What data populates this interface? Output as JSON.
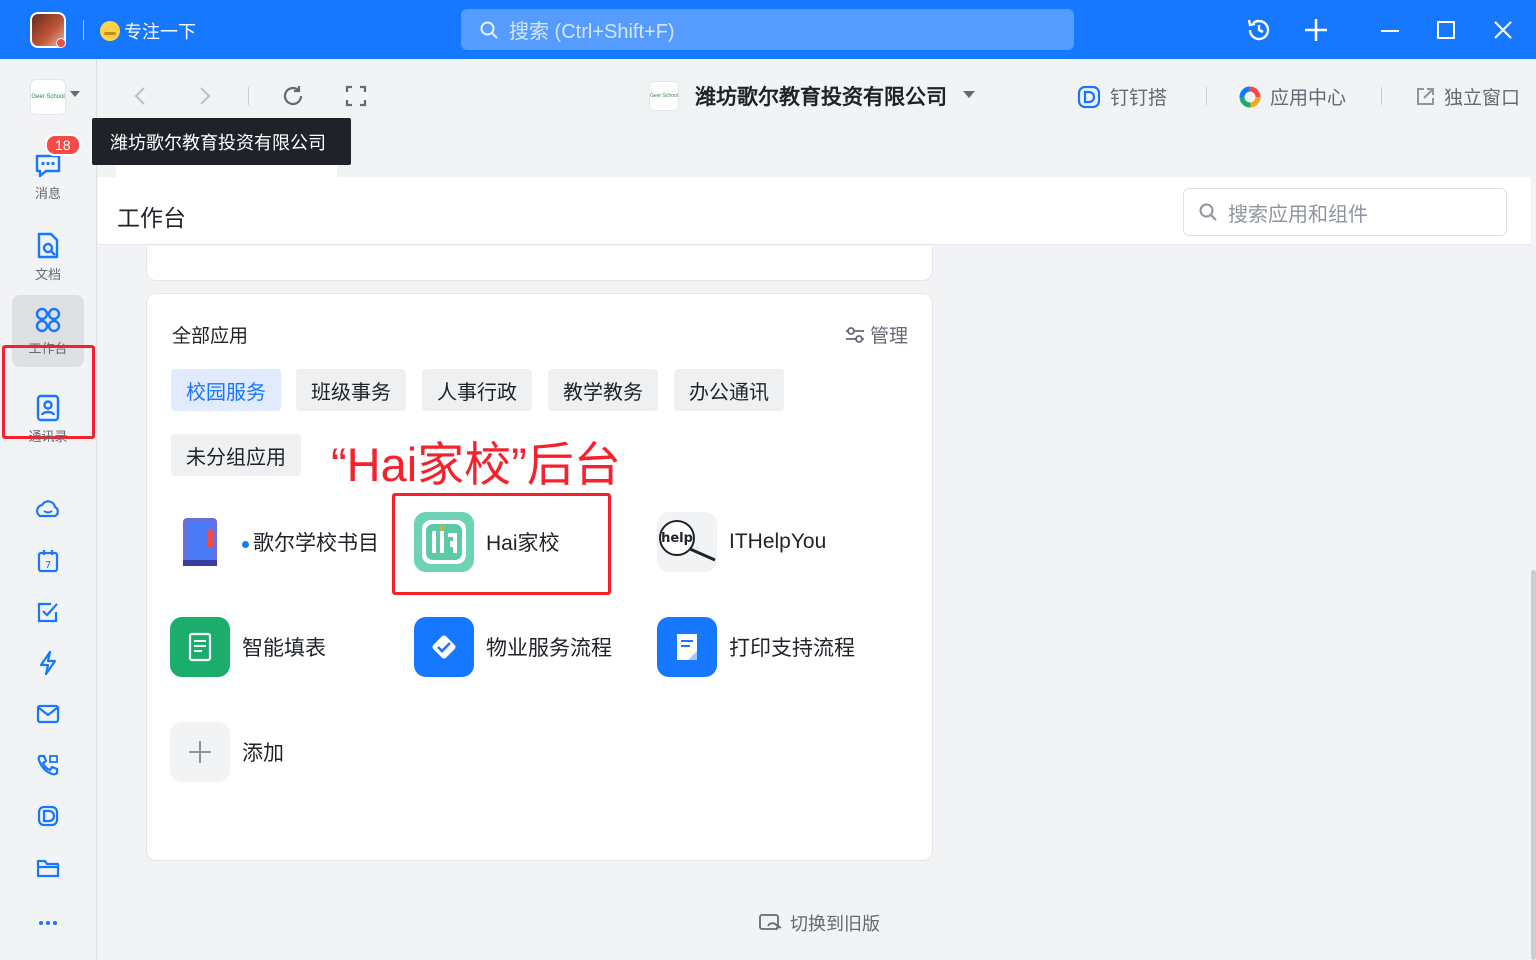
{
  "titlebar": {
    "focus_label": "专注一下",
    "search_placeholder": "搜索 (Ctrl+Shift+F)",
    "icons": [
      "history-icon",
      "plus-icon",
      "minimize-icon",
      "maximize-icon",
      "close-icon"
    ]
  },
  "rail": {
    "org_logo_text": "Geer School",
    "items": [
      {
        "label": "消息",
        "badge": "18"
      },
      {
        "label": "文档"
      },
      {
        "label": "工作台"
      },
      {
        "label": "通讯录"
      }
    ]
  },
  "navbar": {
    "company_logo_text": "Geer School",
    "company_name": "潍坊歌尔教育投资有限公司",
    "links": {
      "dingda": "钉钉搭",
      "app_center": "应用中心",
      "standalone": "独立窗口"
    },
    "tooltip": "潍坊歌尔教育投资有限公司"
  },
  "workspace": {
    "title": "工作台",
    "search_placeholder": "搜索应用和组件",
    "card_title": "全部应用",
    "manage_label": "管理",
    "categories": [
      "校园服务",
      "班级事务",
      "人事行政",
      "教学教务",
      "办公通讯",
      "未分组应用"
    ],
    "annotation": "“Hai家校”后台",
    "apps": [
      {
        "name": "歌尔学校书目"
      },
      {
        "name": "Hai家校"
      },
      {
        "name": "ITHelpYou"
      },
      {
        "name": "智能填表"
      },
      {
        "name": "物业服务流程"
      },
      {
        "name": "打印支持流程"
      }
    ],
    "add_label": "添加",
    "switch_old": "切换到旧版",
    "help_icon_text": "help",
    "colors": {
      "accent": "#1677ff",
      "annotation": "#f5222d",
      "green": "#1aad6b"
    }
  }
}
